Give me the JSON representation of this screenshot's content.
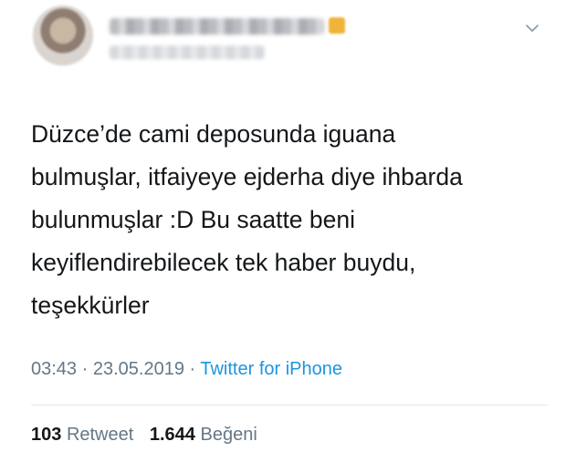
{
  "tweet": {
    "text": "Düzce’de cami deposunda iguana\nbulmuşlar, itfaiyeye ejderha diye ihbarda\nbulunmuşlar :D Bu saatte beni\nkeyiflendirebilecek tek haber buydu,\nteşekkürler",
    "time": "03:43",
    "sep1": " · ",
    "date": "23.05.2019",
    "sep2": " · ",
    "source": "Twitter for iPhone"
  },
  "stats": {
    "retweets": "103",
    "retweets_label": "Retweet",
    "likes": "1.644",
    "likes_label": "Beğeni"
  },
  "icons": {
    "menu": "chevron-down-icon",
    "badge": "verified-badge-icon"
  },
  "colors": {
    "text": "#14171a",
    "secondary": "#657786",
    "link": "#1b95e0",
    "divider": "#e1e8ed"
  }
}
